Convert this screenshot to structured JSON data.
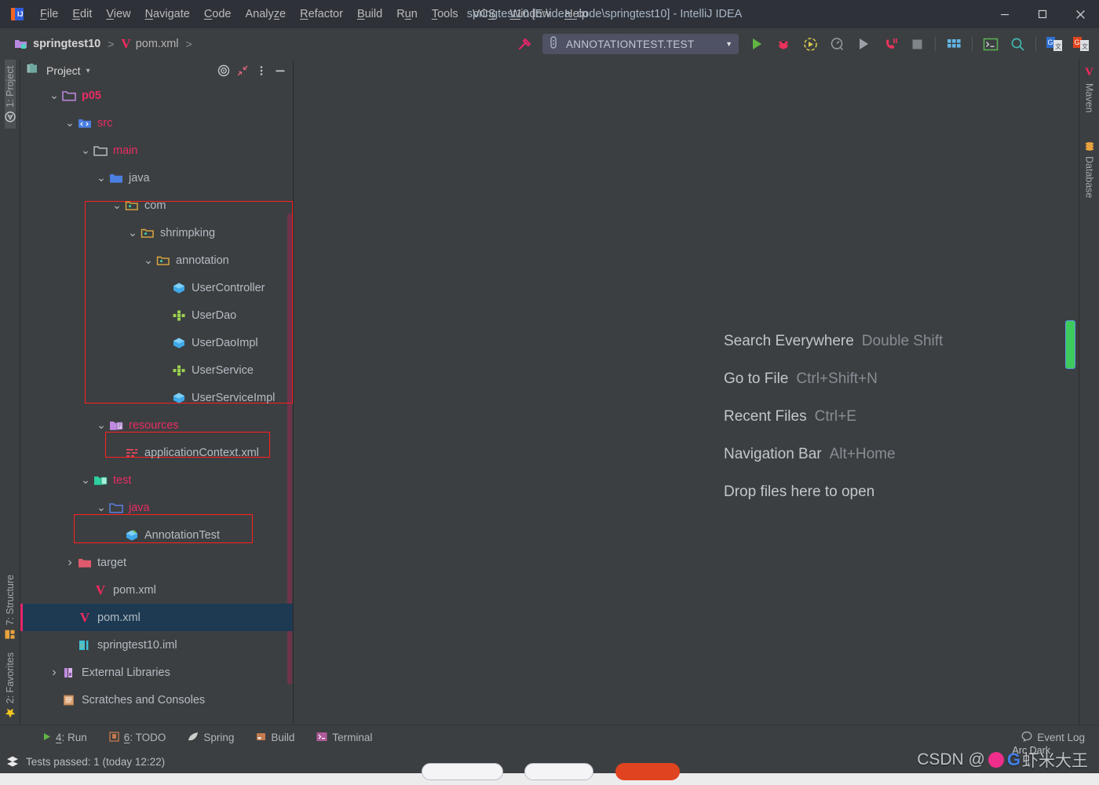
{
  "window": {
    "title": "springtest10 [E:\\idea_code\\springtest10] - IntelliJ IDEA",
    "logo_name": "intellij-idea-logo",
    "minimize_label": "Minimize",
    "maximize_label": "Maximize",
    "close_label": "Close"
  },
  "menubar": {
    "items": [
      {
        "label": "File",
        "mnemonic": "F"
      },
      {
        "label": "Edit",
        "mnemonic": "E"
      },
      {
        "label": "View",
        "mnemonic": "V"
      },
      {
        "label": "Navigate",
        "mnemonic": "N"
      },
      {
        "label": "Code",
        "mnemonic": "C"
      },
      {
        "label": "Analyze",
        "mnemonic": "z"
      },
      {
        "label": "Refactor",
        "mnemonic": "R"
      },
      {
        "label": "Build",
        "mnemonic": "B"
      },
      {
        "label": "Run",
        "mnemonic": "u"
      },
      {
        "label": "Tools",
        "mnemonic": "T"
      },
      {
        "label": "VCS",
        "mnemonic": "S"
      },
      {
        "label": "Window",
        "mnemonic": "W"
      },
      {
        "label": "Help",
        "mnemonic": "H"
      }
    ]
  },
  "navbar": {
    "crumbs": [
      {
        "label": "springtest10",
        "icon": "module-folder-icon",
        "bold": true
      },
      {
        "label": "pom.xml",
        "icon": "maven-icon",
        "bold": false
      }
    ],
    "separator": ">"
  },
  "toolbar": {
    "build_icon": "hammer-icon",
    "run_config": {
      "label": "ANNOTATIONTEST.TEST",
      "icon": "junit-test-icon",
      "caret": "▼"
    },
    "buttons": [
      {
        "name": "run-button",
        "icon": "play-green-icon"
      },
      {
        "name": "debug-button",
        "icon": "bug-red-icon"
      },
      {
        "name": "run-with-coverage-button",
        "icon": "coverage-icon"
      },
      {
        "name": "profiler-button",
        "icon": "profiler-icon"
      },
      {
        "name": "run-anything-button",
        "icon": "play-gray-icon"
      },
      {
        "name": "attach-debugger-button",
        "icon": "phone-pause-icon"
      },
      {
        "name": "stop-button",
        "icon": "stop-square-icon"
      },
      {
        "name": "select-opened-file-button",
        "icon": "grid-blue-icon"
      },
      {
        "name": "terminal-button",
        "icon": "terminal-green-icon"
      },
      {
        "name": "search-everywhere-button",
        "icon": "search-icon"
      },
      {
        "name": "translate-blue-button",
        "icon": "translate-blue-icon"
      },
      {
        "name": "translate-orange-button",
        "icon": "translate-orange-icon"
      }
    ]
  },
  "left_strip": {
    "top": [
      {
        "label": "1: Project",
        "mnemonic": "1",
        "icon": "project-folder-icon",
        "active": true
      },
      {
        "label": "",
        "icon": "maven-m-icon",
        "active": false
      }
    ],
    "bottom": [
      {
        "label": "7: Structure",
        "mnemonic": "7",
        "icon": "structure-icon"
      },
      {
        "label": "2: Favorites",
        "mnemonic": "2",
        "icon": "star-yellow-icon"
      }
    ]
  },
  "right_strip": {
    "items": [
      {
        "label": "Maven",
        "icon": "maven-v-icon"
      },
      {
        "label": "Database",
        "icon": "database-icon"
      }
    ]
  },
  "project_panel": {
    "title": "Project",
    "caret": "⌄",
    "tools": [
      {
        "name": "select-opened-file-tool",
        "icon": "target-icon"
      },
      {
        "name": "collapse-all-tool",
        "icon": "collapse-all-icon"
      },
      {
        "name": "options-tool",
        "icon": "kebab-menu-icon"
      },
      {
        "name": "hide-tool",
        "icon": "minimize-icon"
      }
    ],
    "tree": [
      {
        "label": "p05",
        "indent": 1,
        "arrow": "down",
        "icon": "folder-purple-icon",
        "color": "pink",
        "bold": true
      },
      {
        "label": "src",
        "indent": 2,
        "arrow": "down",
        "icon": "source-root-icon",
        "color": "pink",
        "bold": false
      },
      {
        "label": "main",
        "indent": 3,
        "arrow": "down",
        "icon": "folder-outline-icon",
        "color": "pink",
        "bold": false
      },
      {
        "label": "java",
        "indent": 4,
        "arrow": "down",
        "icon": "folder-blue-icon",
        "color": "gray",
        "bold": false
      },
      {
        "label": "com",
        "indent": 5,
        "arrow": "down",
        "icon": "package-icon",
        "color": "gray",
        "bold": false
      },
      {
        "label": "shrimpking",
        "indent": 6,
        "arrow": "down",
        "icon": "package-icon",
        "color": "gray",
        "bold": false
      },
      {
        "label": "annotation",
        "indent": 7,
        "arrow": "down",
        "icon": "package-icon",
        "color": "gray",
        "bold": false
      },
      {
        "label": "UserController",
        "indent": 8,
        "arrow": "none",
        "icon": "java-class-icon",
        "color": "gray",
        "bold": false
      },
      {
        "label": "UserDao",
        "indent": 8,
        "arrow": "none",
        "icon": "java-interface-icon",
        "color": "gray",
        "bold": false
      },
      {
        "label": "UserDaoImpl",
        "indent": 8,
        "arrow": "none",
        "icon": "java-class-icon",
        "color": "gray",
        "bold": false
      },
      {
        "label": "UserService",
        "indent": 8,
        "arrow": "none",
        "icon": "java-interface-icon",
        "color": "gray",
        "bold": false
      },
      {
        "label": "UserServiceImpl",
        "indent": 8,
        "arrow": "none",
        "icon": "java-class-icon",
        "color": "gray",
        "bold": false
      },
      {
        "label": "resources",
        "indent": 4,
        "arrow": "down",
        "icon": "resources-root-icon",
        "color": "pink",
        "bold": false
      },
      {
        "label": "applicationContext.xml",
        "indent": 5,
        "arrow": "none",
        "icon": "spring-xml-icon",
        "color": "gray",
        "bold": false
      },
      {
        "label": "test",
        "indent": 3,
        "arrow": "down",
        "icon": "test-root-icon",
        "color": "pink",
        "bold": false
      },
      {
        "label": "java",
        "indent": 4,
        "arrow": "down",
        "icon": "folder-test-icon",
        "color": "pink",
        "bold": false
      },
      {
        "label": "AnnotationTest",
        "indent": 5,
        "arrow": "none",
        "icon": "java-test-class-icon",
        "color": "gray",
        "bold": false
      },
      {
        "label": "target",
        "indent": 2,
        "arrow": "right",
        "icon": "folder-excluded-icon",
        "color": "gray",
        "bold": false
      },
      {
        "label": "pom.xml",
        "indent": 3,
        "arrow": "none",
        "icon": "maven-icon",
        "color": "gray",
        "bold": false
      },
      {
        "label": "pom.xml",
        "indent": 2,
        "arrow": "none",
        "icon": "maven-icon",
        "color": "gray",
        "bold": false,
        "selected": true
      },
      {
        "label": "springtest10.iml",
        "indent": 2,
        "arrow": "none",
        "icon": "iml-icon",
        "color": "gray",
        "bold": false
      },
      {
        "label": "External Libraries",
        "indent": 1,
        "arrow": "right",
        "icon": "libraries-icon",
        "color": "gray",
        "bold": false
      },
      {
        "label": "Scratches and Consoles",
        "indent": 1,
        "arrow": "none",
        "icon": "scratches-icon",
        "color": "gray",
        "bold": false
      }
    ]
  },
  "editor": {
    "hints": [
      {
        "action": "Search Everywhere",
        "shortcut": "Double Shift"
      },
      {
        "action": "Go to File",
        "shortcut": "Ctrl+Shift+N"
      },
      {
        "action": "Recent Files",
        "shortcut": "Ctrl+E"
      },
      {
        "action": "Navigation Bar",
        "shortcut": "Alt+Home"
      },
      {
        "action": "Drop files here to open",
        "shortcut": ""
      }
    ]
  },
  "bottom_tabs": [
    {
      "label": "4: Run",
      "mnemonic": "4",
      "icon": "play-green-icon"
    },
    {
      "label": "6: TODO",
      "mnemonic": "6",
      "icon": "todo-icon"
    },
    {
      "label": "Spring",
      "mnemonic": "",
      "icon": "spring-leaf-icon"
    },
    {
      "label": "Build",
      "mnemonic": "",
      "icon": "build-icon"
    },
    {
      "label": "Terminal",
      "mnemonic": "",
      "icon": "terminal-pink-icon"
    }
  ],
  "event_log": {
    "label": "Event Log",
    "icon": "event-log-icon"
  },
  "statusbar": {
    "message": "Tests passed: 1 (today 12:22)",
    "icon": "layers-icon"
  },
  "watermark": {
    "text_left": "CSDN @",
    "text_right": "虾米大王",
    "sub_text": "Arc Dark"
  },
  "colors": {
    "background": "#3c3f41",
    "titlebar": "#2e3138",
    "accent_pink": "#ea2c64",
    "selection": "#1d3a52",
    "highlight_box": "#ff1f1f",
    "text": "#b4bcc4",
    "green": "#62b543"
  }
}
